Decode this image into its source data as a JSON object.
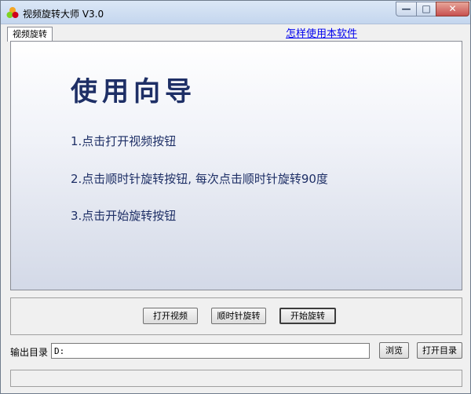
{
  "window": {
    "title": "视频旋转大师 V3.0",
    "controls": {
      "minimize": "—",
      "maximize": "□",
      "close": "✕"
    }
  },
  "tabs": [
    {
      "label": "视频旋转",
      "selected": true
    }
  ],
  "help_link": "怎样使用本软件",
  "guide": {
    "title": "使用向导",
    "steps": [
      "1.点击打开视频按钮",
      "2.点击顺时针旋转按钮, 每次点击顺时针旋转90度",
      "3.点击开始旋转按钮"
    ]
  },
  "actions": {
    "open_video": "打开视频",
    "rotate_clockwise": "顺时针旋转",
    "start_rotate": "开始旋转"
  },
  "output": {
    "label": "输出目录",
    "value": "D:",
    "browse": "浏览",
    "open_dir": "打开目录"
  },
  "colors": {
    "guide_text": "#1e2f66",
    "link": "#0000ee"
  }
}
